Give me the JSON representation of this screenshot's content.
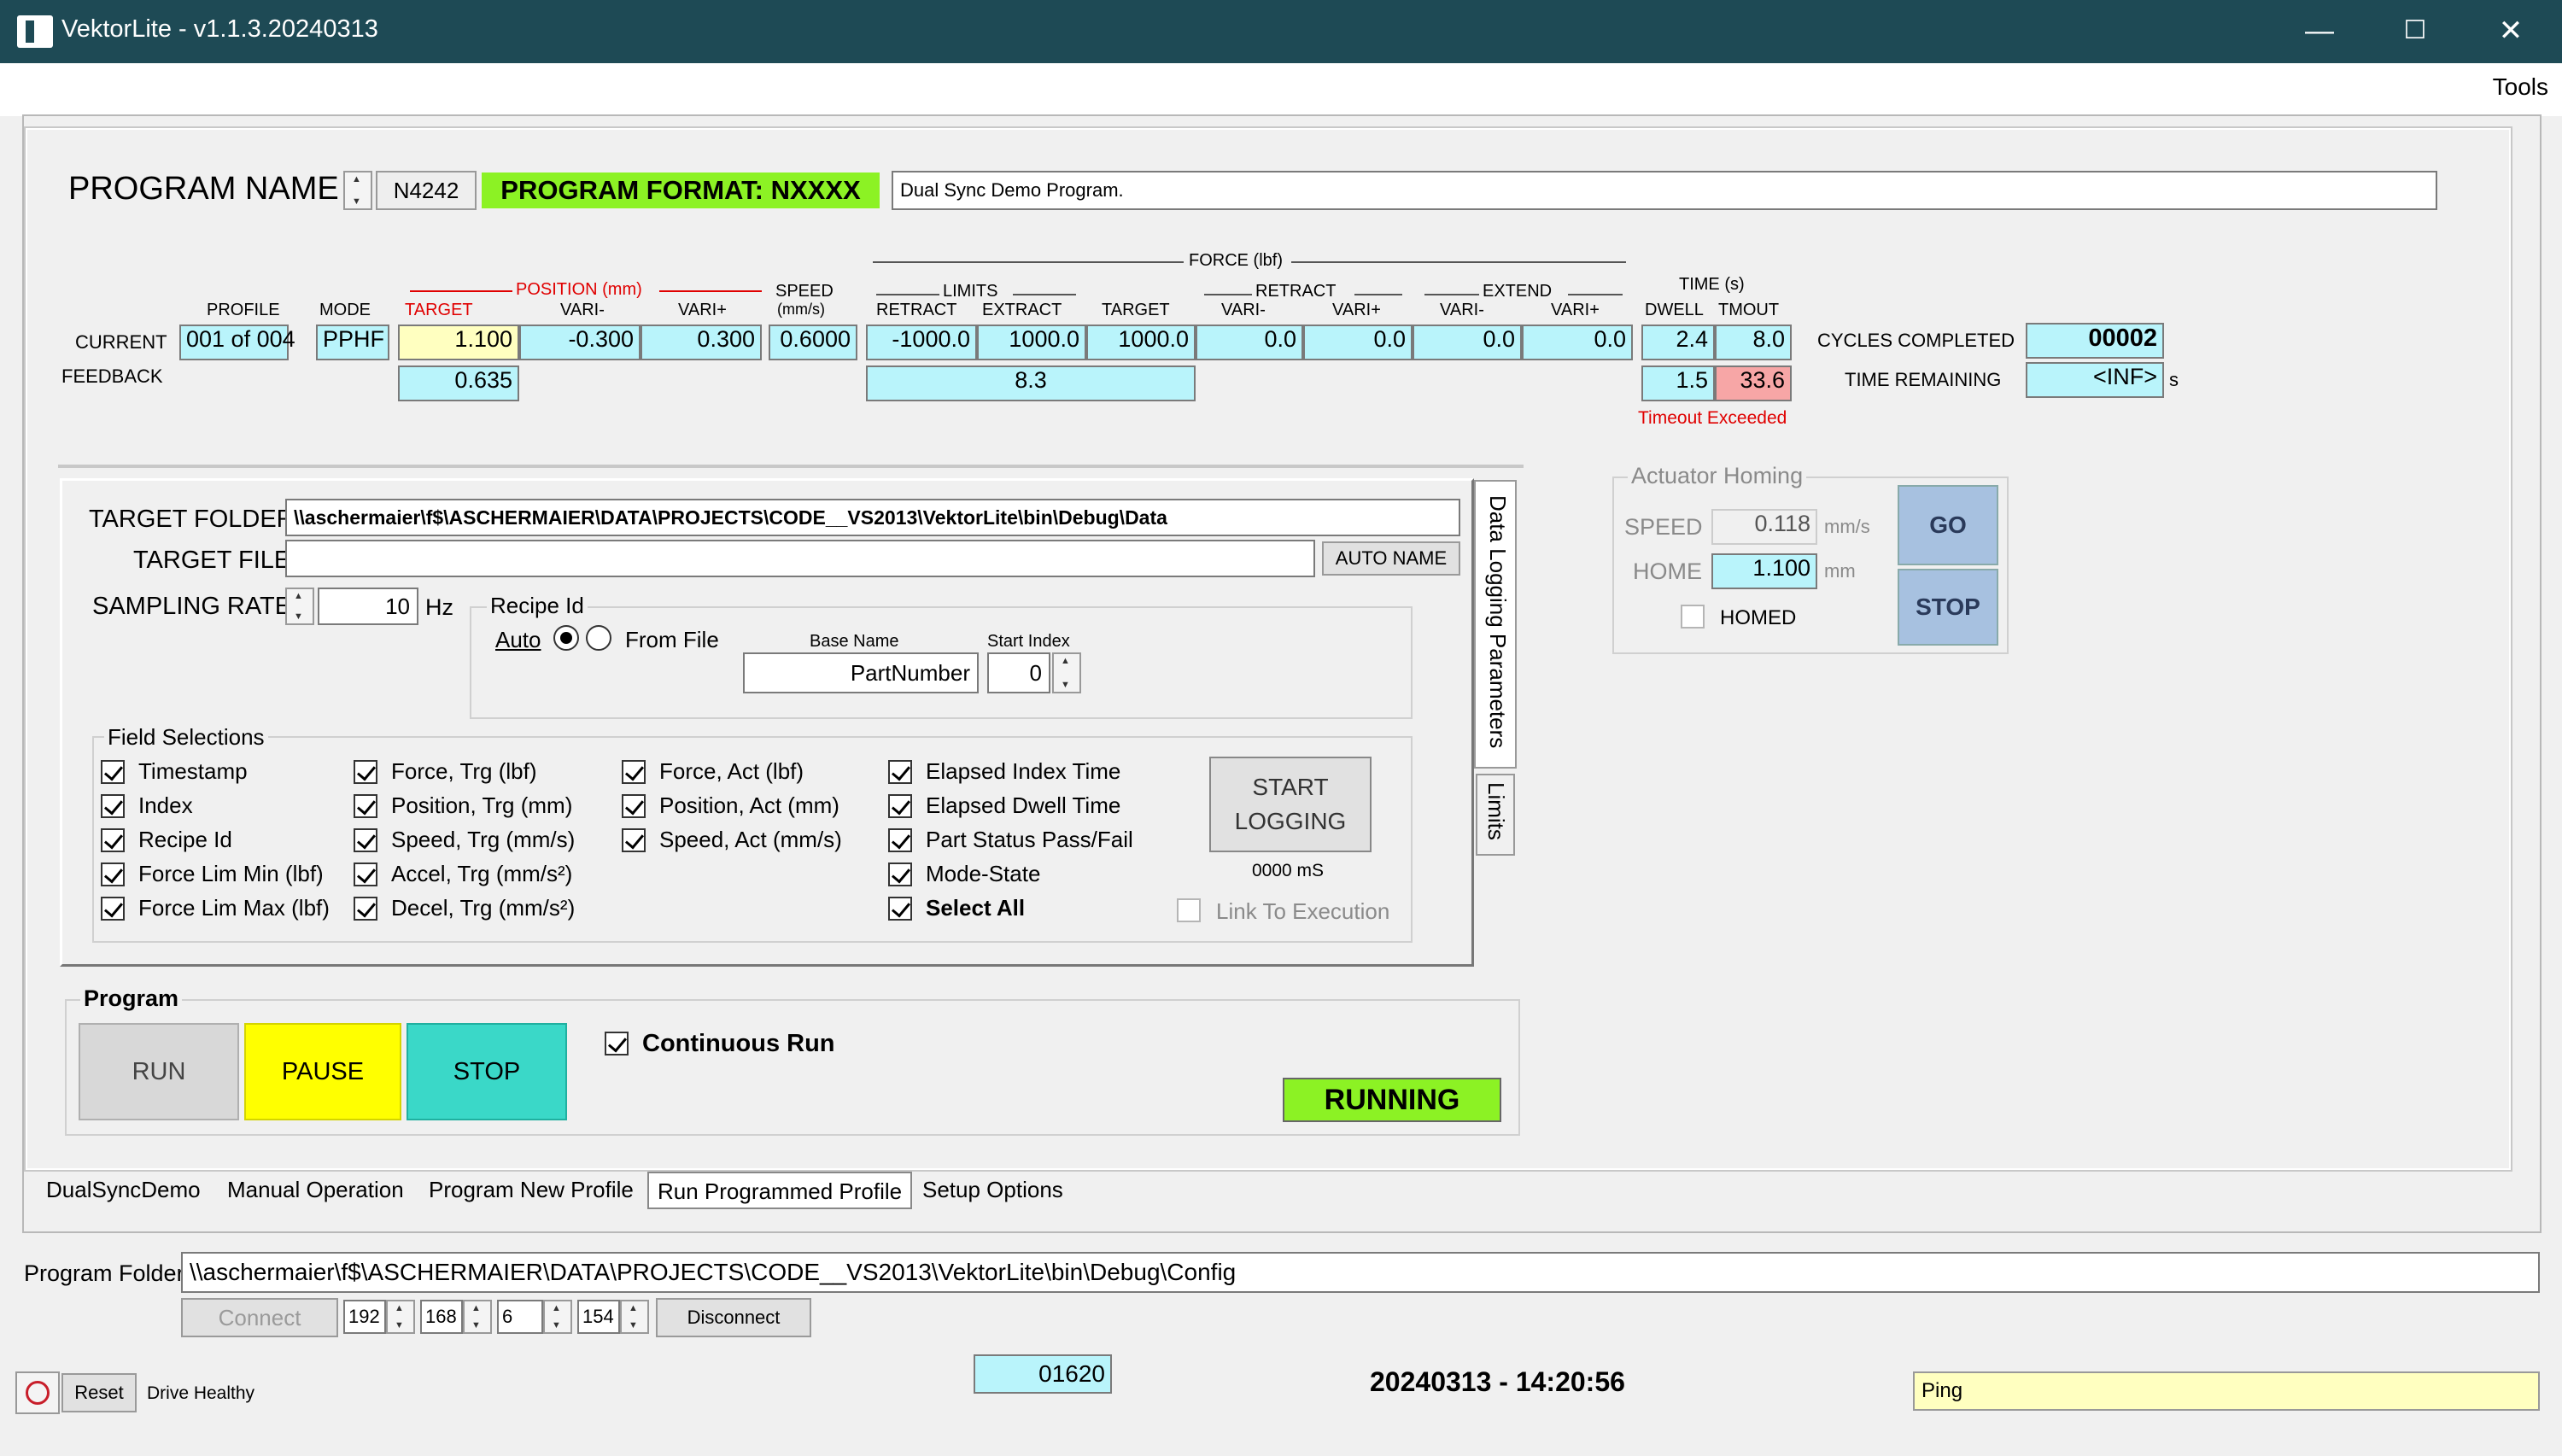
{
  "window": {
    "title": "VektorLite - v1.1.3.20240313",
    "min": "—",
    "max": "☐",
    "close": "✕"
  },
  "menu": {
    "tools": "Tools"
  },
  "program": {
    "name_label": "PROGRAM NAME",
    "name_value": "N4242",
    "format": "PROGRAM FORMAT: NXXXX",
    "description": "Dual Sync Demo Program."
  },
  "headers": {
    "profile": "PROFILE",
    "mode": "MODE",
    "position": "POSITION (mm)",
    "pos_target": "TARGET",
    "pos_vari_minus": "VARI-",
    "pos_vari_plus": "VARI+",
    "speed": "SPEED",
    "speed_unit": "(mm/s)",
    "force": "FORCE (lbf)",
    "limits": "LIMITS",
    "lim_retract": "RETRACT",
    "lim_extract": "EXTRACT",
    "f_target": "TARGET",
    "retract": "RETRACT",
    "ret_vari_minus": "VARI-",
    "ret_vari_plus": "VARI+",
    "extend": "EXTEND",
    "ext_vari_minus": "VARI-",
    "ext_vari_plus": "VARI+",
    "time": "TIME (s)",
    "dwell": "DWELL",
    "tmout": "TMOUT"
  },
  "current": {
    "label": "CURRENT",
    "profile": "001 of 004",
    "mode": "PPHF",
    "target": "1.100",
    "vari_minus": "-0.300",
    "vari_plus": "0.300",
    "speed": "0.6000",
    "retract": "-1000.0",
    "extract": "1000.0",
    "f_target": "1000.0",
    "ret_vm": "0.0",
    "ret_vp": "0.0",
    "ext_vm": "0.0",
    "ext_vp": "0.0",
    "dwell": "2.4",
    "tmout": "8.0"
  },
  "feedback": {
    "label": "FEEDBACK",
    "position": "0.635",
    "force": "8.3",
    "dwell": "1.5",
    "tmout": "33.6",
    "timeout_msg": "Timeout Exceeded"
  },
  "cycles": {
    "completed_label": "CYCLES COMPLETED",
    "completed": "00002",
    "remaining_label": "TIME REMAINING",
    "remaining": "<INF>",
    "unit": "s"
  },
  "logging": {
    "target_folder_label": "TARGET FOLDER",
    "target_folder": "\\\\aschermaier\\f$\\ASCHERMAIER\\DATA\\PROJECTS\\CODE__VS2013\\VektorLite\\bin\\Debug\\Data",
    "target_file_label": "TARGET FILE",
    "target_file": "",
    "auto_name": "AUTO NAME",
    "sampling_label": "SAMPLING RATE",
    "sampling_value": "10",
    "sampling_unit": "Hz",
    "recipe_title": "Recipe Id",
    "auto": "Auto",
    "from_file": "From File",
    "base_name_label": "Base Name",
    "base_name": "PartNumber",
    "start_index_label": "Start Index",
    "start_index": "0",
    "field_title": "Field Selections",
    "start_btn_1": "START",
    "start_btn_2": "LOGGING",
    "ms": "0000 mS",
    "link": "Link To Execution",
    "side_tab_1": "Data Logging Parameters",
    "side_tab_2": "Limits",
    "fields": [
      [
        "Timestamp",
        "Index",
        "Recipe Id",
        "Force Lim Min (lbf)",
        "Force Lim Max (lbf)"
      ],
      [
        "Force, Trg (lbf)",
        "Position, Trg (mm)",
        "Speed, Trg (mm/s)",
        "Accel, Trg (mm/s²)",
        "Decel, Trg (mm/s²)"
      ],
      [
        "Force, Act (lbf)",
        "Position, Act (mm)",
        "Speed, Act (mm/s)"
      ],
      [
        "Elapsed Index Time",
        "Elapsed Dwell Time",
        "Part Status Pass/Fail",
        "Mode-State",
        "Select All"
      ]
    ]
  },
  "homing": {
    "title": "Actuator Homing",
    "speed_label": "SPEED",
    "speed": "0.118",
    "speed_unit": "mm/s",
    "home_label": "HOME",
    "home": "1.100",
    "home_unit": "mm",
    "homed": "HOMED",
    "go": "GO",
    "stop": "STOP"
  },
  "run": {
    "title": "Program",
    "run": "RUN",
    "pause": "PAUSE",
    "stop": "STOP",
    "continuous": "Continuous Run",
    "status": "RUNNING"
  },
  "tabs": [
    "DualSyncDemo",
    "Manual Operation",
    "Program New Profile",
    "Run Programmed Profile",
    "Setup Options"
  ],
  "bottom": {
    "program_folder_label": "Program Folder",
    "program_folder": "\\\\aschermaier\\f$\\ASCHERMAIER\\DATA\\PROJECTS\\CODE__VS2013\\VektorLite\\bin\\Debug\\Config",
    "connect": "Connect",
    "ip1": "192",
    "ip2": "168",
    "ip3": "6",
    "ip4": "154",
    "disconnect": "Disconnect",
    "reset": "Reset",
    "drive": "Drive Healthy",
    "counter": "01620",
    "datetime": "20240313 - 14:20:56",
    "ping": "Ping"
  },
  "colors": {
    "title_bar": "#1e4a55",
    "format_green": "#8cf224",
    "cyan": "#b9f4fb",
    "pause_yellow": "#ffff00",
    "stop_teal": "#3ad8c8",
    "running_green": "#8cf224",
    "ping_yellow": "#ffffc0"
  }
}
